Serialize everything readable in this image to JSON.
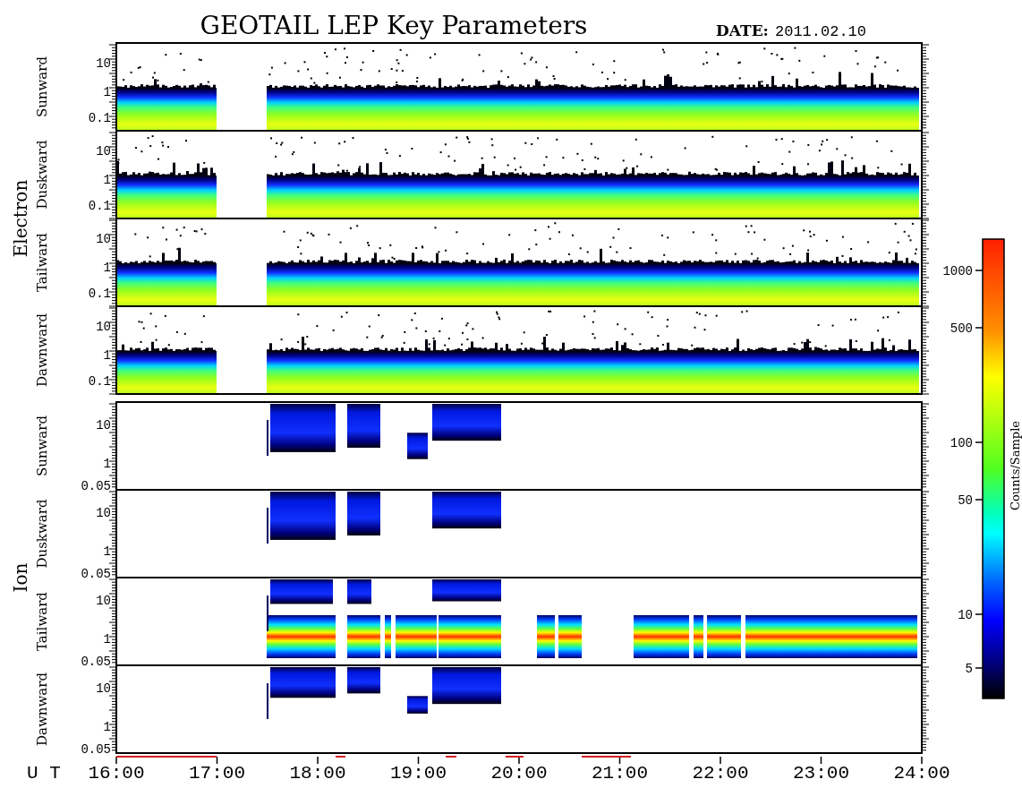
{
  "title": "GEOTAIL LEP Key Parameters",
  "date": {
    "label": "DATE:",
    "value": "2011.02.10"
  },
  "groups": [
    {
      "label": "Electron",
      "kind": "electron",
      "panels": [
        {
          "label": "Sunward",
          "yticks": [
            "10",
            "1",
            "0.1"
          ]
        },
        {
          "label": "Duskward",
          "yticks": [
            "10",
            "1",
            "0.1"
          ]
        },
        {
          "label": "Tailward",
          "yticks": [
            "10",
            "1",
            "0.1"
          ]
        },
        {
          "label": "Dawnward",
          "yticks": [
            "10",
            "1",
            "0.1"
          ]
        }
      ]
    },
    {
      "label": "Ion",
      "kind": "ion",
      "panels": [
        {
          "label": "Sunward",
          "yticks": [
            "10",
            "1",
            "0.05"
          ]
        },
        {
          "label": "Duskward",
          "yticks": [
            "10",
            "1",
            "0.05"
          ]
        },
        {
          "label": "Tailward",
          "yticks": [
            "10",
            "1",
            "0.05"
          ]
        },
        {
          "label": "Dawnward",
          "yticks": [
            "10",
            "1",
            "0.05"
          ]
        }
      ]
    }
  ],
  "time_axis": {
    "label": "U T",
    "ticks": [
      "16:00",
      "17:00",
      "18:00",
      "19:00",
      "20:00",
      "21:00",
      "22:00",
      "23:00",
      "24:00"
    ]
  },
  "colorbar": {
    "label": "Counts/Sample",
    "ticks": [
      "1000",
      "500",
      "100",
      "50",
      "10",
      "5"
    ]
  }
}
